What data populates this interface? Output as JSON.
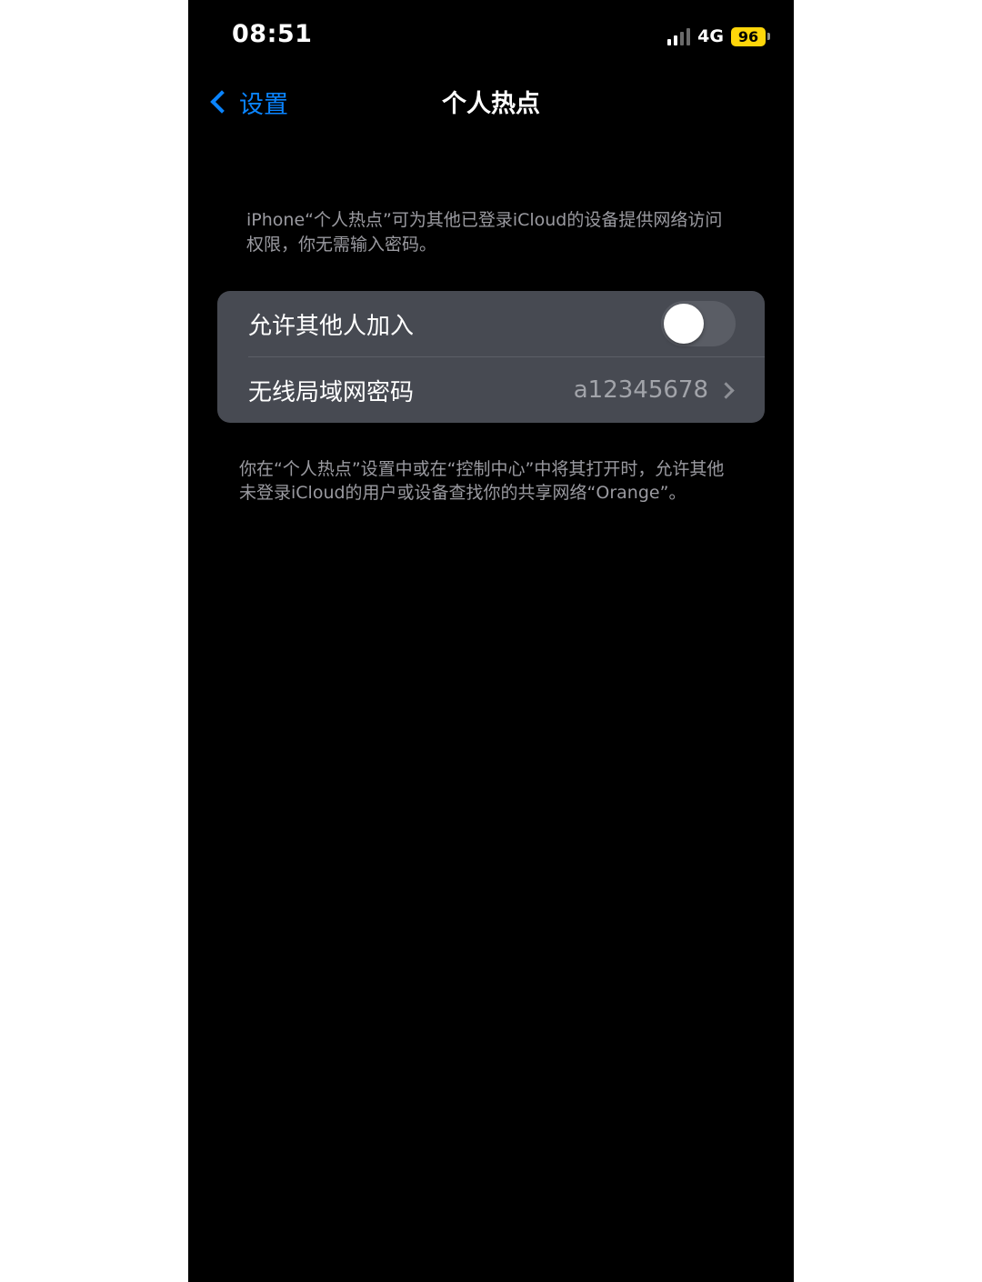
{
  "status_bar": {
    "time": "08:51",
    "network": "4G",
    "battery_level": "96",
    "battery_color": "#ffd60a",
    "signal_icon": "cellular-signal-icon"
  },
  "nav": {
    "back_label": "设置",
    "back_icon": "chevron-left-icon",
    "title": "个人热点"
  },
  "description_top": "iPhone“个人热点”可为其他已登录iCloud的设备提供网络访问权限，你无需输入密码。",
  "settings": {
    "allow_others": {
      "label": "允许其他人加入",
      "enabled": false
    },
    "wifi_password": {
      "label": "无线局域网密码",
      "value": "a12345678"
    }
  },
  "description_bottom": "你在“个人热点”设置中或在“控制中心”中将其打开时，允许其他未登录iCloud的用户或设备查找你的共享网络“Orange”。",
  "colors": {
    "accent": "#0a84ff",
    "background": "#000000",
    "group_background": "#474a52"
  }
}
